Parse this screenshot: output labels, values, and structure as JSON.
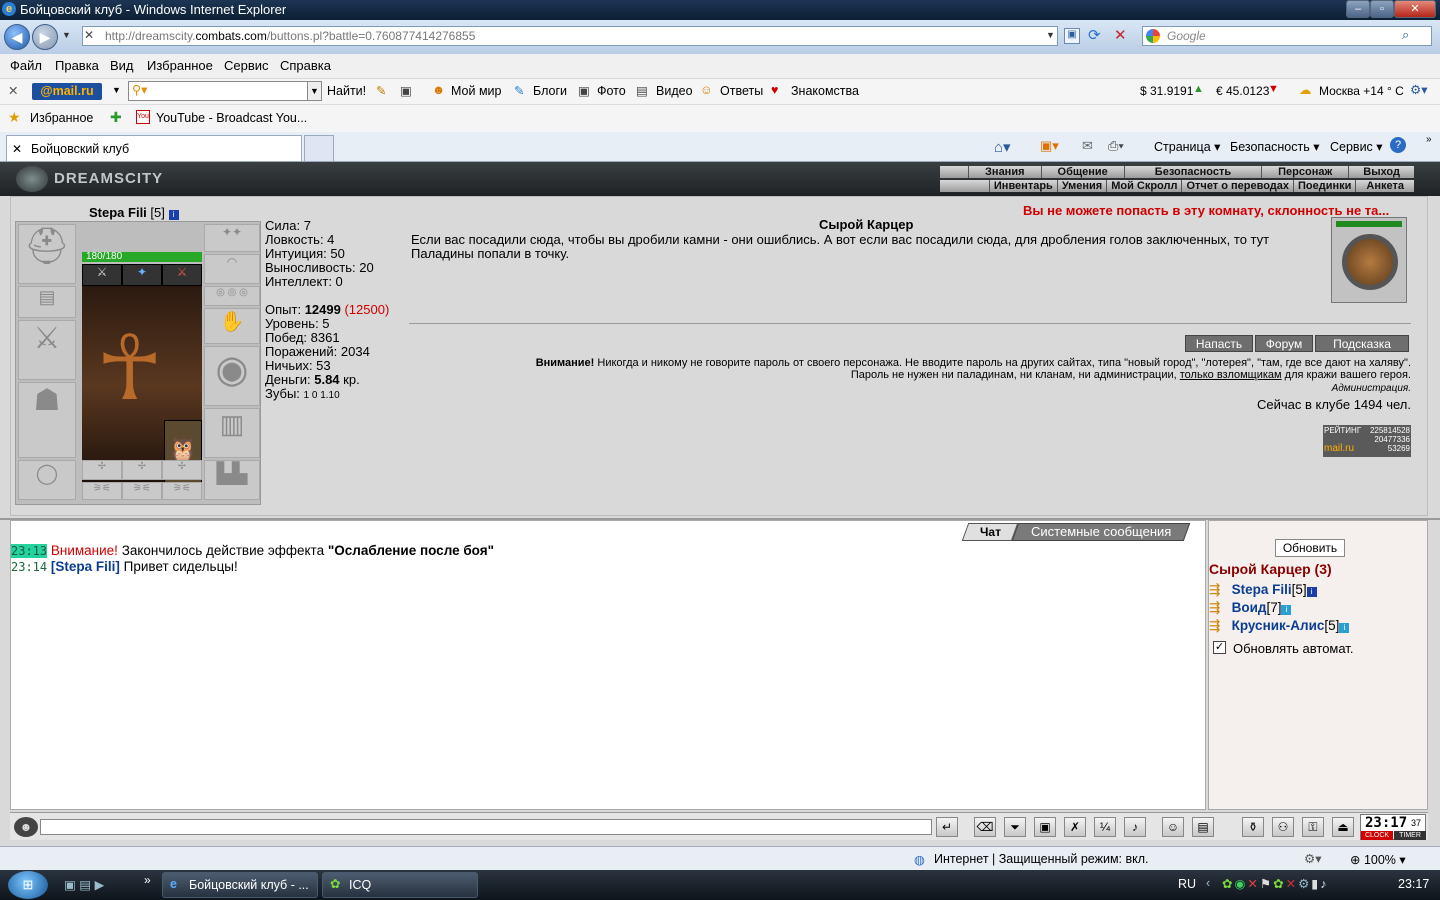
{
  "window": {
    "title": "Бойцовский клуб - Windows Internet Explorer"
  },
  "address": {
    "url_prefix": "http://dreamscity.",
    "url_host": "combats.com",
    "url_path": "/buttons.pl?battle=0.760877414276855",
    "search_placeholder": "Google"
  },
  "menu": [
    "Файл",
    "Правка",
    "Вид",
    "Избранное",
    "Сервис",
    "Справка"
  ],
  "mailbar": {
    "logo": "@mail.ru",
    "search_button": "Найти!",
    "links": [
      "Мой мир",
      "Блоги",
      "Фото",
      "Видео",
      "Ответы",
      "Знакомства"
    ],
    "usd": "$ 31.9191",
    "eur": "€ 45.0123",
    "weather": "Москва +14 ° C"
  },
  "favbar": {
    "favorites": "Избранное",
    "link": "YouTube - Broadcast You..."
  },
  "tabbar": {
    "tab": "Бойцовский клуб",
    "tools": [
      "Страница",
      "Безопасность",
      "Сервис"
    ]
  },
  "game": {
    "logo": "DREAMSCITY",
    "nav_top": [
      "Знания",
      "Общение",
      "Безопасность",
      "Персонаж",
      "Выход"
    ],
    "nav_bottom": [
      "Инвентарь",
      "Умения",
      "Мой Скролл",
      "Отчет о переводах",
      "Поединки",
      "Анкета"
    ],
    "char_name": "Stepa Fili",
    "char_level": "[5]",
    "hp": "180/180",
    "stats": {
      "strength": "Сила: 7",
      "agility": "Ловкость: 4",
      "intuition": "Интуиция: 50",
      "stamina": "Выносливость: 20",
      "intellect": "Интеллект: 0",
      "exp_label": "Опыт:",
      "exp_value": "12499",
      "exp_next": "(12500)",
      "level": "Уровень: 5",
      "wins": "Побед: 8361",
      "losses": "Поражений: 2034",
      "draws": "Ничьих: 53",
      "money_label": "Деньги:",
      "money_value": "5.84",
      "money_unit": "кр.",
      "teeth_label": "Зубы:",
      "teeth_values": "1 0 1.10"
    },
    "warning_top": "Вы не можете попасть в эту комнату, склонность не та...",
    "room_title": "Сырой Карцер",
    "room_desc": "Если вас посадили сюда, чтобы вы дробили камни - они ошиблись. А вот если вас посадили сюда, для дробления голов заключенных, то тут Паладины попали в точку.",
    "buttons": [
      "Напасть",
      "Форум",
      "Подсказка"
    ],
    "notice_bold": "Внимание!",
    "notice_text": "Никогда и никому не говорите пароль от своего персонажа. Не вводите пароль на других сайтах, типа \"новый город\", \"лотерея\", \"там, где все дают на халяву\".",
    "notice_text2": "Пароль не нужен ни паладинам, ни кланам, ни администрации,",
    "notice_link": "только взломщикам",
    "notice_text3": "для кражи вашего героя.",
    "admin": "Администрация.",
    "online": "Сейчас в клубе 1494 чел.",
    "rating_label": "РЕЙТИНГ",
    "rating_num1": "225814528",
    "rating_num2": "20477336",
    "rating_num3": "53269",
    "rating_logo": "mail.ru"
  },
  "chat": {
    "tabs": [
      "Чат",
      "Системные сообщения"
    ],
    "msg1": {
      "time": "23:13",
      "label": "Внимание!",
      "text": "Закончилось действие эффекта",
      "effect": "\"Ослабление после боя\""
    },
    "msg2": {
      "time": "23:14",
      "name": "[Stepa Fili]",
      "text": "Привет сидельцы!"
    }
  },
  "sidepanel": {
    "refresh": "Обновить",
    "room": "Сырой Карцер (3)",
    "users": [
      {
        "name": "Stepa Fili",
        "level": "[5]"
      },
      {
        "name": "Воид",
        "level": "[7]"
      },
      {
        "name": "Крусник-Алис",
        "level": "[5]"
      }
    ],
    "auto": "Обновлять автомат."
  },
  "clock": {
    "time": "23:17",
    "sec": "37",
    "clock_label": "CLOCK",
    "timer_label": "TIMER"
  },
  "statusbar": {
    "zone": "Интернет | Защищенный режим: вкл.",
    "zoom": "100%"
  },
  "taskbar": {
    "items": [
      "Бойцовский клуб - ...",
      "ICQ"
    ],
    "lang": "RU",
    "time": "23:17"
  },
  "colors": {
    "accent_red": "#d00000",
    "hp_green": "#27a827",
    "nick_blue": "#0b3d91",
    "time_highlight": "#22d3a0"
  }
}
